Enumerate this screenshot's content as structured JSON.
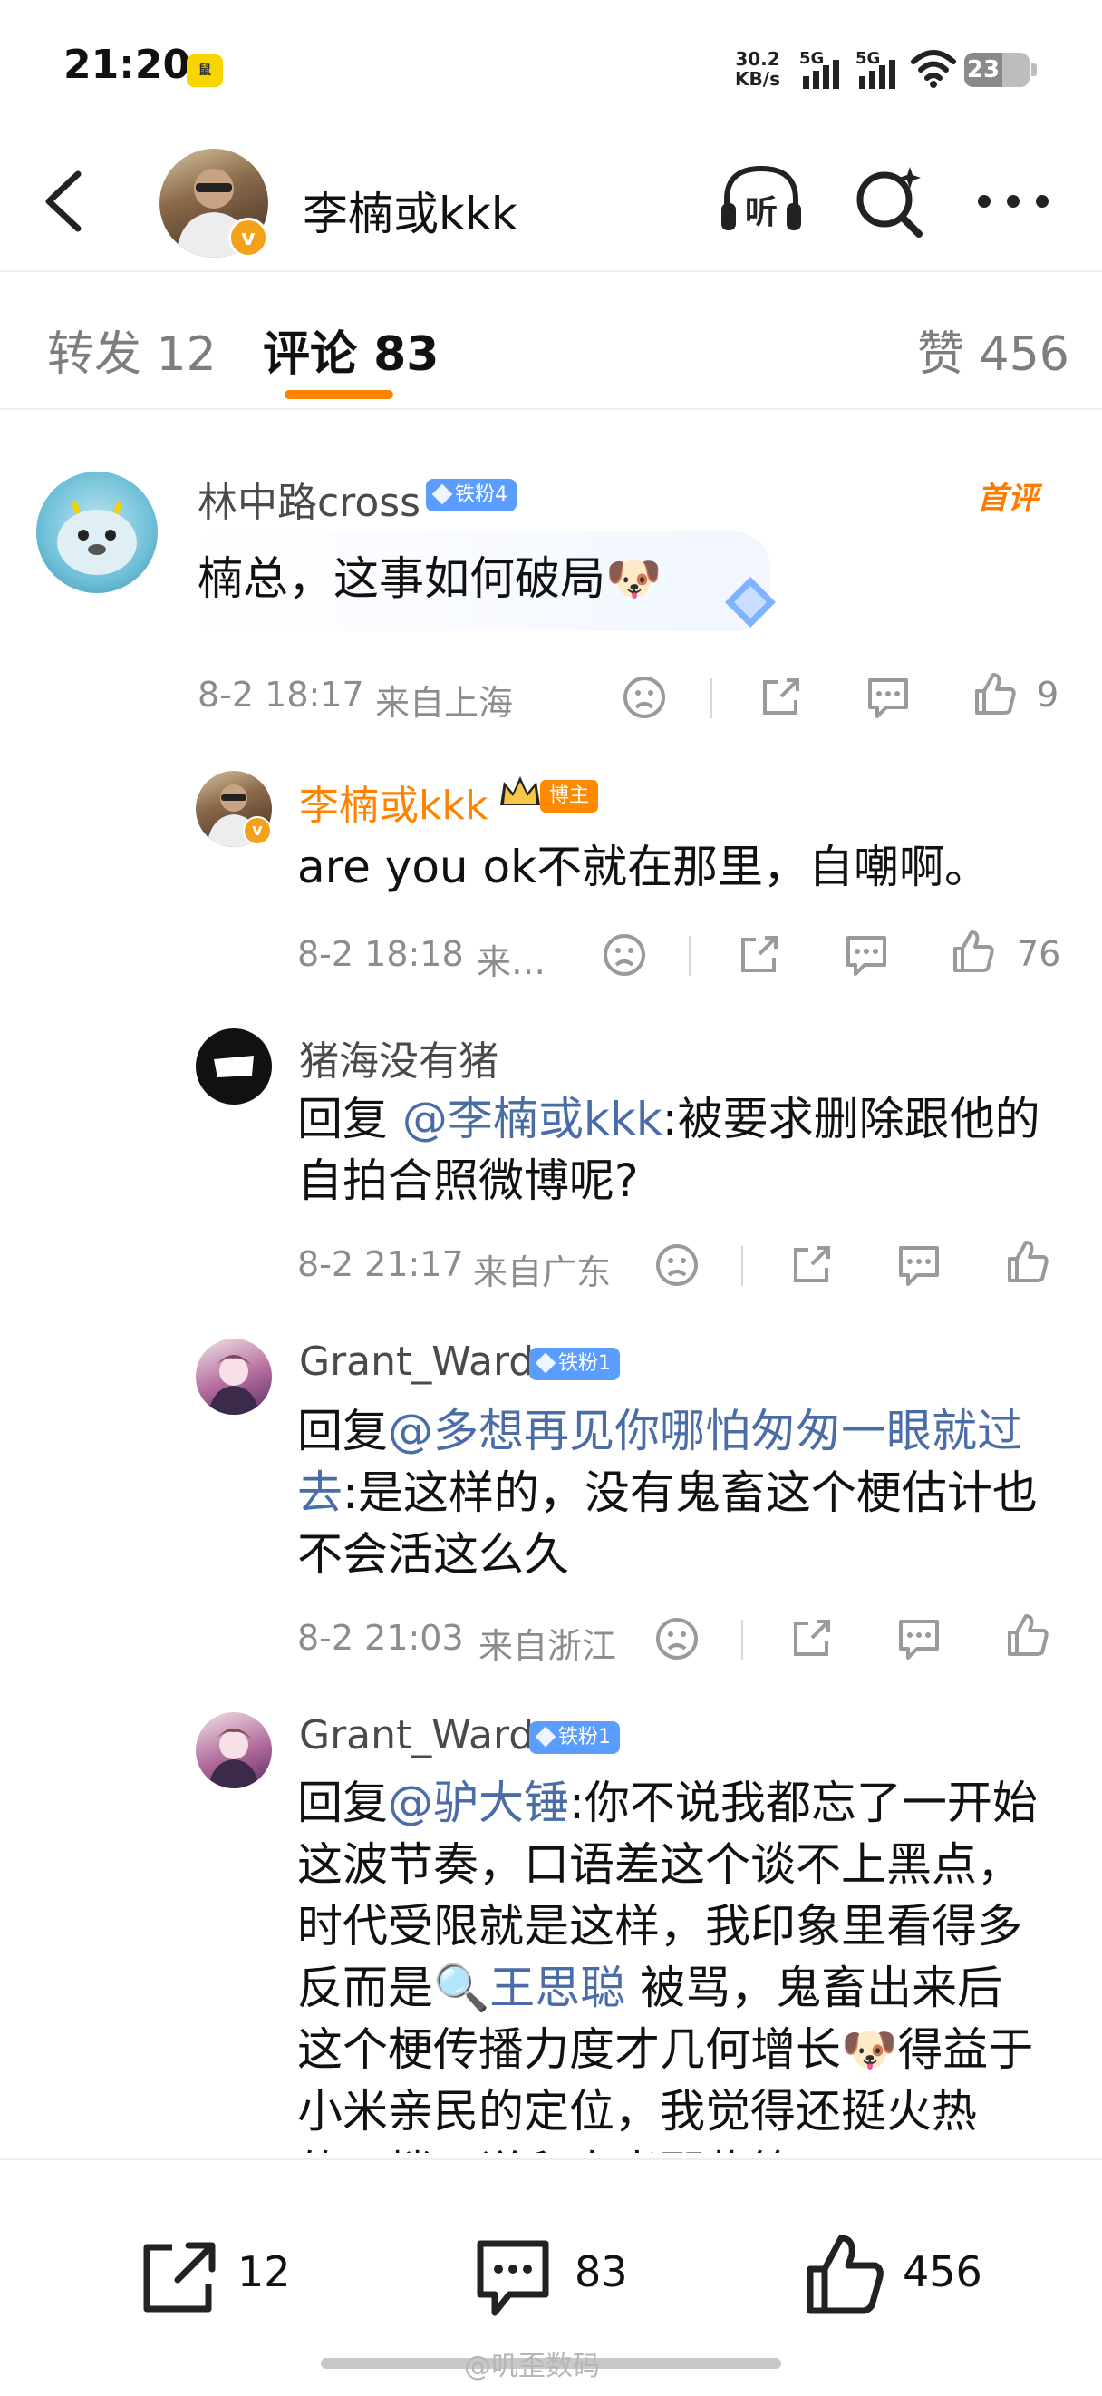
{
  "status": {
    "time": "21:20",
    "badge": "鼠",
    "net_speed_value": "30.2",
    "net_speed_unit": "KB/s",
    "sim1": "5G",
    "sim2": "5G",
    "battery": "23"
  },
  "header": {
    "name": "李楠或kkk",
    "listen_label": "听"
  },
  "tabs": {
    "repost": "转发 12",
    "comments": "评论 83",
    "likes": "赞 456"
  },
  "comments": [
    {
      "user": "林中路cross",
      "fan_badge": "铁粉4",
      "first_tag": "首评",
      "text": "楠总，这事如何破局🐶",
      "time": "8-2 18:17",
      "location": "来自上海",
      "likes": "9"
    },
    {
      "user": "李楠或kkk",
      "author_badge": "博主",
      "text": "are you ok不就在那里，自嘲啊。",
      "time": "8-2 18:18",
      "location": "来…",
      "likes": "76"
    },
    {
      "user": "猪海没有猪",
      "reply_prefix": "回复 ",
      "reply_to": "@李楠或kkk",
      "text": ":被要求删除跟他的自拍合照微博呢?",
      "time": "8-2 21:17",
      "location": "来自广东"
    },
    {
      "user": "Grant_Ward",
      "fan_badge": "铁粉1",
      "reply_prefix": "回复",
      "reply_to": "@多想再见你哪怕匆匆一眼就过去",
      "text": ":是这样的，没有鬼畜这个梗估计也不会活这么久",
      "time": "8-2 21:03",
      "location": "来自浙江"
    },
    {
      "user": "Grant_Ward",
      "fan_badge": "铁粉1",
      "reply_prefix": "回复",
      "reply_to": "@驴大锤",
      "text_a": ":你不说我都忘了一开始这波节奏，口语差这个谈不上黑点，时代受限就是这样，我印象里看得多反而是",
      "search_topic": "王思聪",
      "text_b": " 被骂，鬼畜出来后这个梗传播力度才几何增长🐶得益于小米亲民的定位，我觉得还挺火热的，楼下说和真米那些等"
    }
  ],
  "bottom_bar": {
    "reposts": "12",
    "comments": "83",
    "likes": "456"
  },
  "watermark": "@叽歪数码",
  "colors": {
    "accent": "#ff8200",
    "mention": "#4a6da7",
    "fan_badge": "#5a9dff",
    "author_name": "#ff8200"
  }
}
